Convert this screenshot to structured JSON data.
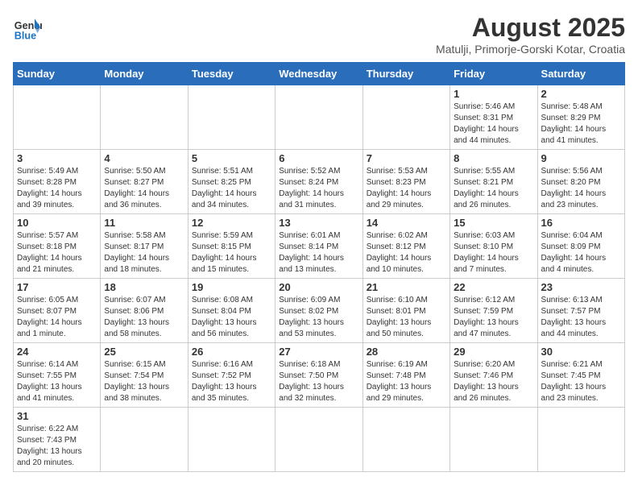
{
  "header": {
    "logo_general": "General",
    "logo_blue": "Blue",
    "title": "August 2025",
    "subtitle": "Matulji, Primorje-Gorski Kotar, Croatia"
  },
  "days_of_week": [
    "Sunday",
    "Monday",
    "Tuesday",
    "Wednesday",
    "Thursday",
    "Friday",
    "Saturday"
  ],
  "weeks": [
    [
      {
        "day": "",
        "info": ""
      },
      {
        "day": "",
        "info": ""
      },
      {
        "day": "",
        "info": ""
      },
      {
        "day": "",
        "info": ""
      },
      {
        "day": "",
        "info": ""
      },
      {
        "day": "1",
        "info": "Sunrise: 5:46 AM\nSunset: 8:31 PM\nDaylight: 14 hours and 44 minutes."
      },
      {
        "day": "2",
        "info": "Sunrise: 5:48 AM\nSunset: 8:29 PM\nDaylight: 14 hours and 41 minutes."
      }
    ],
    [
      {
        "day": "3",
        "info": "Sunrise: 5:49 AM\nSunset: 8:28 PM\nDaylight: 14 hours and 39 minutes."
      },
      {
        "day": "4",
        "info": "Sunrise: 5:50 AM\nSunset: 8:27 PM\nDaylight: 14 hours and 36 minutes."
      },
      {
        "day": "5",
        "info": "Sunrise: 5:51 AM\nSunset: 8:25 PM\nDaylight: 14 hours and 34 minutes."
      },
      {
        "day": "6",
        "info": "Sunrise: 5:52 AM\nSunset: 8:24 PM\nDaylight: 14 hours and 31 minutes."
      },
      {
        "day": "7",
        "info": "Sunrise: 5:53 AM\nSunset: 8:23 PM\nDaylight: 14 hours and 29 minutes."
      },
      {
        "day": "8",
        "info": "Sunrise: 5:55 AM\nSunset: 8:21 PM\nDaylight: 14 hours and 26 minutes."
      },
      {
        "day": "9",
        "info": "Sunrise: 5:56 AM\nSunset: 8:20 PM\nDaylight: 14 hours and 23 minutes."
      }
    ],
    [
      {
        "day": "10",
        "info": "Sunrise: 5:57 AM\nSunset: 8:18 PM\nDaylight: 14 hours and 21 minutes."
      },
      {
        "day": "11",
        "info": "Sunrise: 5:58 AM\nSunset: 8:17 PM\nDaylight: 14 hours and 18 minutes."
      },
      {
        "day": "12",
        "info": "Sunrise: 5:59 AM\nSunset: 8:15 PM\nDaylight: 14 hours and 15 minutes."
      },
      {
        "day": "13",
        "info": "Sunrise: 6:01 AM\nSunset: 8:14 PM\nDaylight: 14 hours and 13 minutes."
      },
      {
        "day": "14",
        "info": "Sunrise: 6:02 AM\nSunset: 8:12 PM\nDaylight: 14 hours and 10 minutes."
      },
      {
        "day": "15",
        "info": "Sunrise: 6:03 AM\nSunset: 8:10 PM\nDaylight: 14 hours and 7 minutes."
      },
      {
        "day": "16",
        "info": "Sunrise: 6:04 AM\nSunset: 8:09 PM\nDaylight: 14 hours and 4 minutes."
      }
    ],
    [
      {
        "day": "17",
        "info": "Sunrise: 6:05 AM\nSunset: 8:07 PM\nDaylight: 14 hours and 1 minute."
      },
      {
        "day": "18",
        "info": "Sunrise: 6:07 AM\nSunset: 8:06 PM\nDaylight: 13 hours and 58 minutes."
      },
      {
        "day": "19",
        "info": "Sunrise: 6:08 AM\nSunset: 8:04 PM\nDaylight: 13 hours and 56 minutes."
      },
      {
        "day": "20",
        "info": "Sunrise: 6:09 AM\nSunset: 8:02 PM\nDaylight: 13 hours and 53 minutes."
      },
      {
        "day": "21",
        "info": "Sunrise: 6:10 AM\nSunset: 8:01 PM\nDaylight: 13 hours and 50 minutes."
      },
      {
        "day": "22",
        "info": "Sunrise: 6:12 AM\nSunset: 7:59 PM\nDaylight: 13 hours and 47 minutes."
      },
      {
        "day": "23",
        "info": "Sunrise: 6:13 AM\nSunset: 7:57 PM\nDaylight: 13 hours and 44 minutes."
      }
    ],
    [
      {
        "day": "24",
        "info": "Sunrise: 6:14 AM\nSunset: 7:55 PM\nDaylight: 13 hours and 41 minutes."
      },
      {
        "day": "25",
        "info": "Sunrise: 6:15 AM\nSunset: 7:54 PM\nDaylight: 13 hours and 38 minutes."
      },
      {
        "day": "26",
        "info": "Sunrise: 6:16 AM\nSunset: 7:52 PM\nDaylight: 13 hours and 35 minutes."
      },
      {
        "day": "27",
        "info": "Sunrise: 6:18 AM\nSunset: 7:50 PM\nDaylight: 13 hours and 32 minutes."
      },
      {
        "day": "28",
        "info": "Sunrise: 6:19 AM\nSunset: 7:48 PM\nDaylight: 13 hours and 29 minutes."
      },
      {
        "day": "29",
        "info": "Sunrise: 6:20 AM\nSunset: 7:46 PM\nDaylight: 13 hours and 26 minutes."
      },
      {
        "day": "30",
        "info": "Sunrise: 6:21 AM\nSunset: 7:45 PM\nDaylight: 13 hours and 23 minutes."
      }
    ],
    [
      {
        "day": "31",
        "info": "Sunrise: 6:22 AM\nSunset: 7:43 PM\nDaylight: 13 hours and 20 minutes."
      },
      {
        "day": "",
        "info": ""
      },
      {
        "day": "",
        "info": ""
      },
      {
        "day": "",
        "info": ""
      },
      {
        "day": "",
        "info": ""
      },
      {
        "day": "",
        "info": ""
      },
      {
        "day": "",
        "info": ""
      }
    ]
  ]
}
